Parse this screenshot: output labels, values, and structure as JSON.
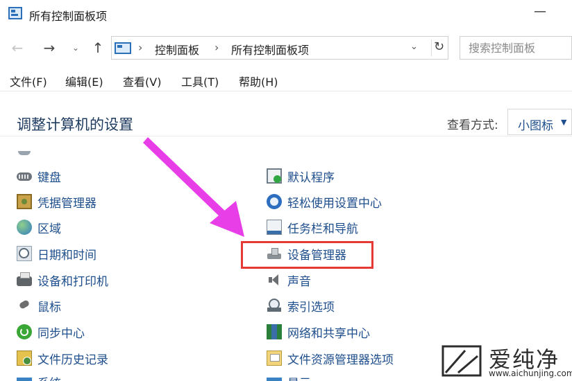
{
  "window": {
    "title": "所有控制面板项",
    "minimize": "—"
  },
  "nav": {
    "back": "←",
    "forward": "→",
    "dropdown": "⌄",
    "up": "↑"
  },
  "address": {
    "crumbs": [
      "控制面板",
      "所有控制面板项"
    ],
    "separator": "›",
    "dropdown": "⌄",
    "refresh": "↻"
  },
  "search": {
    "placeholder": "搜索控制面板"
  },
  "menu": [
    "文件(F)",
    "编辑(E)",
    "查看(V)",
    "工具(T)",
    "帮助(H)"
  ],
  "content": {
    "title": "调整计算机的设置",
    "view_by_label": "查看方式:",
    "view_by_value": "小图标",
    "view_by_arrow": "▼"
  },
  "items_left": [
    {
      "label": "键盘",
      "icon": "keyboard-icon"
    },
    {
      "label": "凭据管理器",
      "icon": "credential-manager-icon"
    },
    {
      "label": "区域",
      "icon": "region-icon"
    },
    {
      "label": "日期和时间",
      "icon": "date-time-icon"
    },
    {
      "label": "设备和打印机",
      "icon": "printer-icon"
    },
    {
      "label": "鼠标",
      "icon": "mouse-icon"
    },
    {
      "label": "同步中心",
      "icon": "sync-center-icon"
    },
    {
      "label": "文件历史记录",
      "icon": "file-history-icon"
    },
    {
      "label": "系统",
      "icon": "system-icon"
    }
  ],
  "items_right": [
    {
      "label": "默认程序",
      "icon": "default-programs-icon"
    },
    {
      "label": "轻松使用设置中心",
      "icon": "ease-of-access-icon"
    },
    {
      "label": "任务栏和导航",
      "icon": "taskbar-icon"
    },
    {
      "label": "设备管理器",
      "icon": "device-manager-icon"
    },
    {
      "label": "声音",
      "icon": "sound-icon"
    },
    {
      "label": "索引选项",
      "icon": "indexing-options-icon"
    },
    {
      "label": "网络和共享中心",
      "icon": "network-sharing-icon"
    },
    {
      "label": "文件资源管理器选项",
      "icon": "explorer-options-icon"
    },
    {
      "label": "显示",
      "icon": "display-icon"
    }
  ],
  "annotation": {
    "arrow_color": "#e83ee8",
    "highlight_color": "#e53935"
  },
  "watermark": {
    "text": "爱纯净",
    "url": "www.aichunjing.com"
  }
}
